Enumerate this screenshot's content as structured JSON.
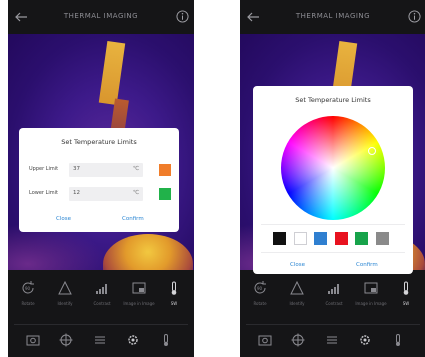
{
  "app": {
    "title": "THERMAL IMAGING"
  },
  "toolbar": {
    "tools": [
      {
        "label": "Rotate",
        "icon": "rotate-icon"
      },
      {
        "label": "Identify",
        "icon": "triangle-icon"
      },
      {
        "label": "Contrast",
        "icon": "signal-bars-icon"
      },
      {
        "label": "Image in Image",
        "icon": "picture-in-picture-icon"
      },
      {
        "label": "SW",
        "icon": "thermometer-icon"
      }
    ],
    "bottom_icons": [
      "camera-icon",
      "target-icon",
      "list-icon",
      "settings-icon",
      "thermometer-icon"
    ]
  },
  "limits_dialog": {
    "title": "Set Temperature Limits",
    "upper_label": "Upper Limit",
    "upper_value": "37",
    "lower_label": "Lower Limit",
    "lower_value": "12",
    "unit": "℃",
    "upper_color": "#f07d2a",
    "lower_color": "#21b24a",
    "close_label": "Close",
    "confirm_label": "Confirm"
  },
  "color_dialog": {
    "title": "Set Temperature Limits",
    "palette": [
      "#111111",
      "#ffffff",
      "#2f7fd0",
      "#e8121f",
      "#17a34a",
      "#8a8a8a"
    ],
    "close_label": "Close",
    "confirm_label": "Confirm"
  },
  "colors": {
    "accent": "#2b86d3",
    "background": "#151517"
  }
}
